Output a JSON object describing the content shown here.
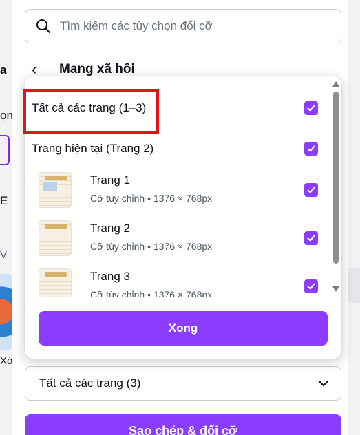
{
  "search": {
    "placeholder": "Tìm kiếm các tùy chọn đổi cỡ"
  },
  "back_row": {
    "title": "Mang xã hôi"
  },
  "popup": {
    "all_pages_label": "Tất cả các trang (1–3)",
    "all_pages_checked": true,
    "current_page_label": "Trang hiện tại (Trang 2)",
    "current_page_checked": true,
    "pages": [
      {
        "name": "Trang 1",
        "size": "Cỡ tùy chỉnh • 1376 × 768px",
        "checked": true
      },
      {
        "name": "Trang 2",
        "size": "Cỡ tùy chỉnh • 1376 × 768px",
        "checked": true
      },
      {
        "name": "Trang 3",
        "size": "Cỡ tùy chỉnh • 1376 × 768px",
        "checked": true
      }
    ],
    "done_label": "Xong"
  },
  "page_select": {
    "value": "Tất cả các trang (3)"
  },
  "copy_resize_label": "Sao chép & đổi cỡ",
  "left_strip": {
    "t1": "a",
    "t2": "ọn",
    "t3": "E",
    "t4": "V",
    "t5": "Xó"
  },
  "colors": {
    "accent": "#8b3dff",
    "highlight": "#e8101a"
  }
}
